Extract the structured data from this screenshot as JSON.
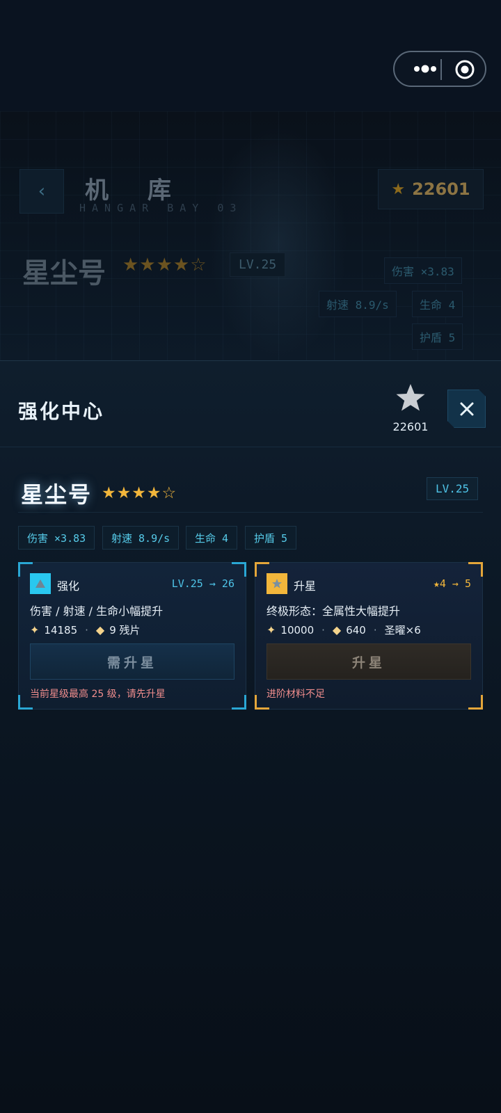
{
  "hangar": {
    "back_icon": "‹",
    "title": "机 库",
    "subtitle": "HANGAR BAY 03",
    "coins": "22601",
    "ship_name": "星尘号",
    "stars": "★★★★☆",
    "level": "LV.25",
    "stats": {
      "damage": "伤害 ×3.83",
      "fire_rate": "射速 8.9/s",
      "hp": "生命 4",
      "shield": "护盾 5"
    }
  },
  "sheet": {
    "title": "强化中心",
    "coins": "22601",
    "ship_name": "星尘号",
    "stars": "★★★★☆",
    "level": "LV.25",
    "stats": [
      "伤害 ×3.83",
      "射速 8.9/s",
      "生命 4",
      "护盾 5"
    ],
    "cards": {
      "upgrade": {
        "label": "强化",
        "level_change": "LV.25 → 26",
        "desc": "伤害 / 射速 / 生命小幅提升",
        "cost_coins": "14185",
        "cost_shards": "9 残片",
        "button": "需升星",
        "note": "当前星级最高 25 级，请先升星"
      },
      "starup": {
        "label": "升星",
        "level_change": "★4 → 5",
        "desc": "终极形态：全属性大幅提升",
        "cost_coins": "10000",
        "cost_shards": "640",
        "cost_extra": "圣曜×6",
        "button": "升星",
        "note": "进阶材料不足"
      }
    }
  },
  "colors": {
    "accent_cyan": "#29c8f0",
    "accent_gold": "#f2b63b",
    "warning": "#f08d8d",
    "background": "#070c14"
  }
}
